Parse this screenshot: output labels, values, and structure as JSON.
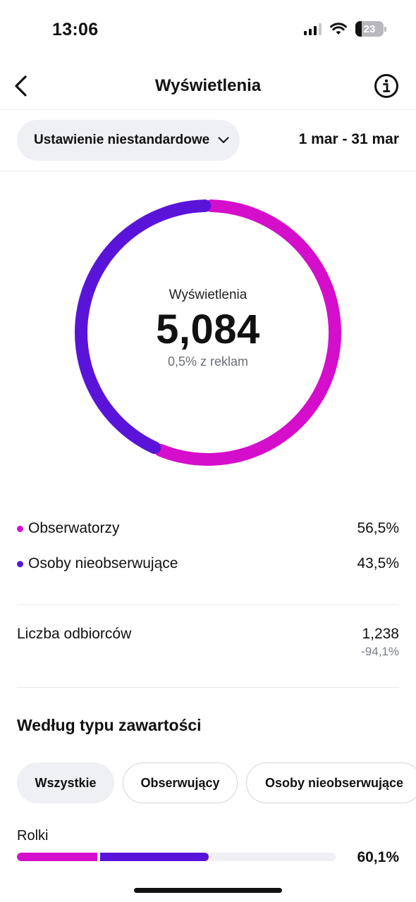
{
  "status_bar": {
    "time": "13:06",
    "battery_level": "23",
    "battery_fraction": 0.23,
    "icons": [
      "cellular-signal-icon",
      "wifi-icon",
      "battery-icon"
    ]
  },
  "header": {
    "title": "Wyświetlenia",
    "back_icon": "chevron-left-icon",
    "info_icon": "info-circle-icon"
  },
  "filter": {
    "range_label": "Ustawienie niestandardowe",
    "dropdown_icon": "chevron-down-icon",
    "date_range": "1 mar - 31 mar"
  },
  "summary": {
    "label": "Wyświetlenia",
    "value": "5,084",
    "ads_note": "0,5% z reklam"
  },
  "chart_data": {
    "type": "pie",
    "variant": "donut",
    "total_label": "Wyświetlenia",
    "total_value": 5084,
    "series": [
      {
        "name": "Obserwatorzy",
        "value": 56.5,
        "color": "#d40ecb"
      },
      {
        "name": "Osoby nieobserwujące",
        "value": 43.5,
        "color": "#5a14d9"
      }
    ]
  },
  "legend": [
    {
      "label": "Obserwatorzy",
      "value": "56,5%",
      "color": "#d40ecb"
    },
    {
      "label": "Osoby nieobserwujące",
      "value": "43,5%",
      "color": "#5a14d9"
    }
  ],
  "reach": {
    "label": "Liczba odbiorców",
    "value": "1,238",
    "change": "-94,1%"
  },
  "content_type": {
    "title": "Według typu zawartości",
    "chips": [
      {
        "label": "Wszystkie",
        "active": true
      },
      {
        "label": "Obserwujący",
        "active": false
      },
      {
        "label": "Osoby nieobserwujące",
        "active": false
      }
    ],
    "rows": [
      {
        "label": "Rolki",
        "percent": "60,1%",
        "followers_fraction": 0.252,
        "non_followers_fraction": 0.349
      }
    ]
  },
  "colors": {
    "followers": "#d40ecb",
    "non_followers": "#5a14d9",
    "chip_bg": "#eff0f4",
    "track_bg": "#efeff4"
  }
}
